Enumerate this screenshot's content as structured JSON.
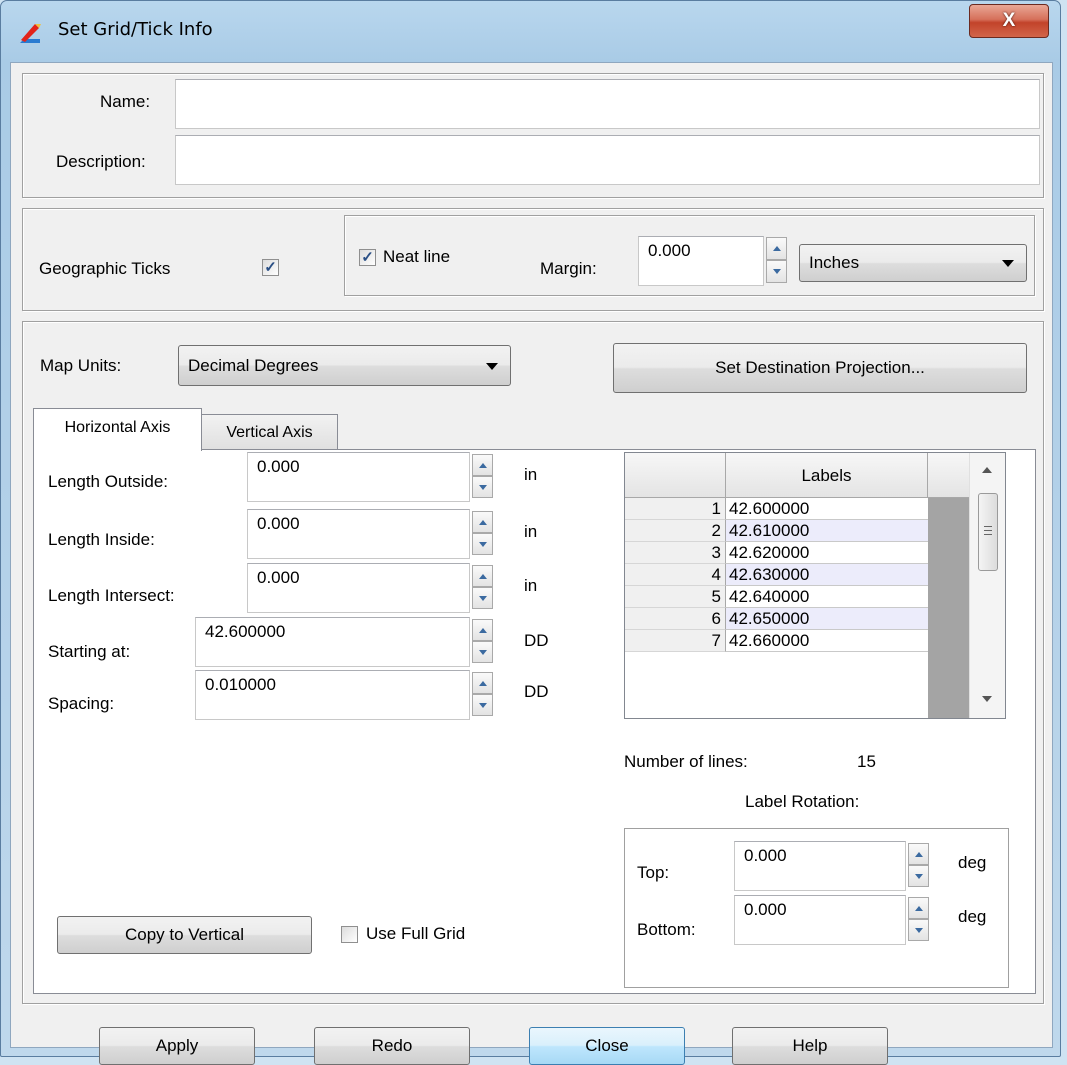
{
  "window": {
    "title": "Set Grid/Tick Info",
    "close_label": "X"
  },
  "identity": {
    "name_label": "Name:",
    "name_value": "",
    "description_label": "Description:",
    "description_value": ""
  },
  "ticks": {
    "geographic_label": "Geographic Ticks",
    "geographic_checked": true,
    "neat_line_label": "Neat line",
    "neat_line_checked": true,
    "margin_label": "Margin:",
    "margin_value": "0.000",
    "margin_units": "Inches"
  },
  "map": {
    "units_label": "Map Units:",
    "units_value": "Decimal Degrees",
    "projection_button": "Set Destination Projection..."
  },
  "tabs": [
    {
      "label": "Horizontal Axis",
      "active": true
    },
    {
      "label": "Vertical Axis",
      "active": false
    }
  ],
  "axis": {
    "length_outside_label": "Length Outside:",
    "length_outside_value": "0.000",
    "length_outside_unit": "in",
    "length_inside_label": "Length Inside:",
    "length_inside_value": "0.000",
    "length_inside_unit": "in",
    "length_intersect_label": "Length Intersect:",
    "length_intersect_value": "0.000",
    "length_intersect_unit": "in",
    "starting_label": "Starting at:",
    "starting_value": "42.600000",
    "starting_unit": "DD",
    "spacing_label": "Spacing:",
    "spacing_value": "0.010000",
    "spacing_unit": "DD",
    "copy_button": "Copy to Vertical",
    "full_grid_label": "Use Full Grid",
    "full_grid_checked": false
  },
  "labels_table": {
    "header": "Labels",
    "rows": [
      {
        "num": "1",
        "value": "42.600000"
      },
      {
        "num": "2",
        "value": "42.610000"
      },
      {
        "num": "3",
        "value": "42.620000"
      },
      {
        "num": "4",
        "value": "42.630000"
      },
      {
        "num": "5",
        "value": "42.640000"
      },
      {
        "num": "6",
        "value": "42.650000"
      },
      {
        "num": "7",
        "value": "42.660000"
      }
    ]
  },
  "lines": {
    "count_label": "Number of lines:",
    "count_value": "15"
  },
  "rotation": {
    "title": "Label Rotation:",
    "top_label": "Top:",
    "top_value": "0.000",
    "top_unit": "deg",
    "bottom_label": "Bottom:",
    "bottom_value": "0.000",
    "bottom_unit": "deg"
  },
  "footer": {
    "apply": "Apply",
    "redo": "Redo",
    "close": "Close",
    "help": "Help"
  }
}
